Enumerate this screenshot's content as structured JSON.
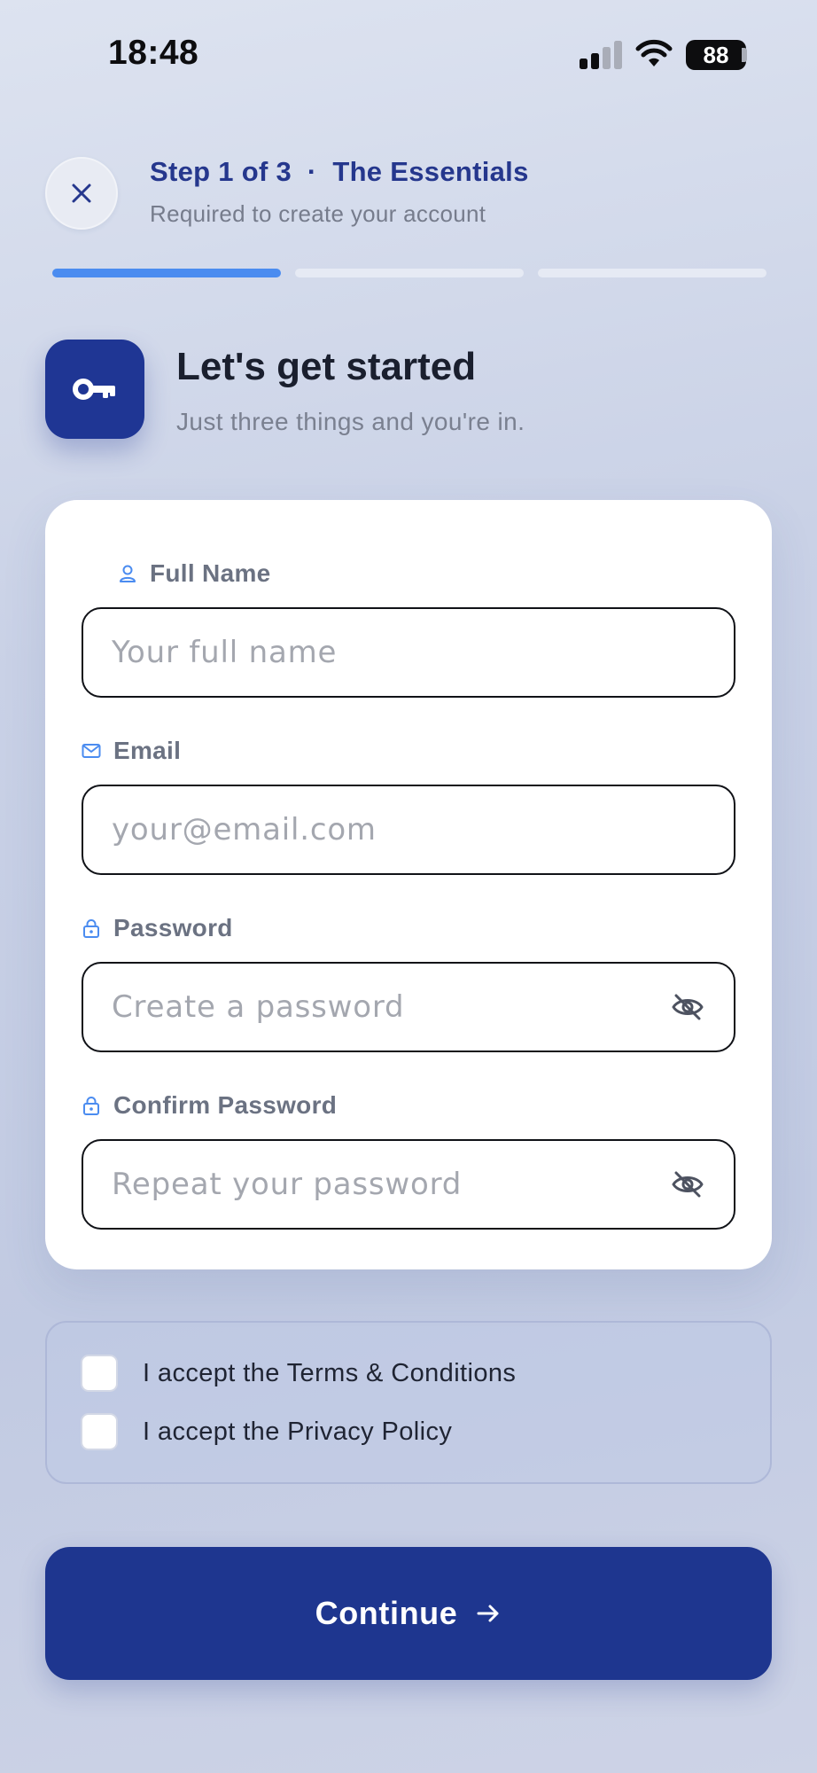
{
  "status_bar": {
    "time": "18:48",
    "battery": "88",
    "icons": [
      "signal-icon",
      "wifi-icon",
      "battery-icon"
    ]
  },
  "header": {
    "close_icon": "close-icon",
    "step_title": "Step 1 of 3  ·  The Essentials",
    "step_subtitle": "Required to create your account",
    "progress": {
      "current_step": 1,
      "total_steps": 3
    }
  },
  "hero": {
    "icon": "key-icon",
    "title": "Let's get started",
    "subtitle": "Just three things and you're in."
  },
  "form": {
    "full_name": {
      "label": "Full Name",
      "icon": "person-icon",
      "placeholder": "Your full name",
      "value": ""
    },
    "email": {
      "label": "Email",
      "icon": "mail-icon",
      "placeholder": "your@email.com",
      "value": ""
    },
    "password": {
      "label": "Password",
      "icon": "lock-icon",
      "placeholder": "Create a password",
      "value": "",
      "toggle_icon": "eye-off-icon"
    },
    "confirm_password": {
      "label": "Confirm Password",
      "icon": "lock-icon",
      "placeholder": "Repeat your password",
      "value": "",
      "toggle_icon": "eye-off-icon"
    }
  },
  "terms": {
    "items": [
      {
        "label": "I accept the Terms & Conditions",
        "checked": false
      },
      {
        "label": "I accept the Privacy Policy",
        "checked": false
      }
    ]
  },
  "continue_button": {
    "label": "Continue",
    "icon": "arrow-right-icon"
  },
  "colors": {
    "primary": "#1e368f",
    "accent": "#4b8cf0",
    "title_blue": "#25378d"
  }
}
